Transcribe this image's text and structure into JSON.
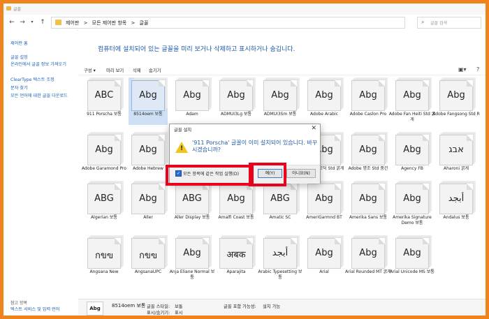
{
  "window": {
    "title": "글꼴"
  },
  "address": {
    "crumbs": [
      "제어판",
      ">",
      "모든 제어판 항목",
      ">",
      "글꼴"
    ],
    "search_placeholder": "글꼴 검색"
  },
  "left_pane": {
    "home": "제어판 홈",
    "links": [
      "글꼴 설정",
      "온라인에서 글꼴 정보 가져오기",
      "ClearType 텍스트 조정",
      "문자 찾기",
      "모든 언어에 대한 글꼴 다운로드"
    ],
    "see_also": "참고 항목",
    "see_also_link": "텍스트 서비스 및 입력 언어"
  },
  "main": {
    "headline": "컴퓨터에 설치되어 있는 글꼴을 미리 보거나 삭제하고 표시하거나 숨깁니다.",
    "toolbar": [
      "구성 ▾",
      "미리 보기",
      "삭제",
      "숨기기"
    ],
    "fonts": [
      {
        "name": "911 Porscha 보통",
        "sample": "ABC"
      },
      {
        "name": "8514oem 보통",
        "sample": "Abg"
      },
      {
        "name": "Adam",
        "sample": "Abg"
      },
      {
        "name": "ADMUI3Lg 보통",
        "sample": "Abg"
      },
      {
        "name": "ADMUI3Sm 보통",
        "sample": "Abg"
      },
      {
        "name": "Adobe Arabic",
        "sample": "Abg"
      },
      {
        "name": "Adobe Caslon Pro",
        "sample": "Abg"
      },
      {
        "name": "Adobe Fan Heiti Std 굵게",
        "sample": "Abg"
      },
      {
        "name": "Adobe Fangsong Std R",
        "sample": "Abg"
      },
      {
        "name": "Adobe Garamond Pro",
        "sample": "Abg"
      },
      {
        "name": "Adobe Hebrew",
        "sample": "Abg"
      },
      {
        "name": "",
        "sample": ""
      },
      {
        "name": "",
        "sample": ""
      },
      {
        "name": "Song Std 굵게",
        "sample": "Abg"
      },
      {
        "name": "Adobe 고딕 Std 굵게",
        "sample": "Abg"
      },
      {
        "name": "Adobe 명조 Std 중간",
        "sample": "Abg"
      },
      {
        "name": "Agency FB",
        "sample": "Abg"
      },
      {
        "name": "Aharoni 굵게",
        "sample": "אבג"
      },
      {
        "name": "Algerian 보통",
        "sample": "ABG"
      },
      {
        "name": "Aller",
        "sample": "Abg"
      },
      {
        "name": "Aller Display 보통",
        "sample": "ABG"
      },
      {
        "name": "Amalfi Coast 보통",
        "sample": "Abg"
      },
      {
        "name": "Amatic SC",
        "sample": "ABG"
      },
      {
        "name": "AmeriGarmnd BT",
        "sample": "Abg"
      },
      {
        "name": "Amerika Sans 보통",
        "sample": "Abg"
      },
      {
        "name": "Amerika Signature Demo 보통",
        "sample": "Abg"
      },
      {
        "name": "Andalus 보통",
        "sample": "أبجد"
      },
      {
        "name": "Angsana New",
        "sample": "กขฃ"
      },
      {
        "name": "AngsanaUPC",
        "sample": "กขฃ"
      },
      {
        "name": "Anja Eliane Normal 보통",
        "sample": "Abg"
      },
      {
        "name": "Aparajita",
        "sample": "अबक"
      },
      {
        "name": "Arabic Typesetting 보통",
        "sample": "أبجد"
      },
      {
        "name": "Arial",
        "sample": "Abg"
      },
      {
        "name": "Arial Rounded MT 굵게",
        "sample": "Abg"
      },
      {
        "name": "Arial Unicode MS 보통",
        "sample": "Abg"
      }
    ]
  },
  "status": {
    "icon_text": "Abg",
    "name": "8514oem 보통",
    "style_label": "글꼴 스타일:",
    "style_value": "보통",
    "show_label": "표시/숨기기:",
    "show_value": "표시",
    "embed_label": "글꼴 포함 가능성:",
    "embed_value": "설치 가능"
  },
  "dialog": {
    "title": "글꼴 설치",
    "message": "'911 Porscha' 글꼴이 이미 설치되어 있습니다. 바꾸시겠습니까?",
    "checkbox": "모든 항목에 같은 작업 실행(D)",
    "yes": "예(Y)",
    "no": "아니요(N)"
  },
  "colors": {
    "accent": "#1e5aa8",
    "frame": "#f0841c",
    "highlight": "#e8001c"
  }
}
